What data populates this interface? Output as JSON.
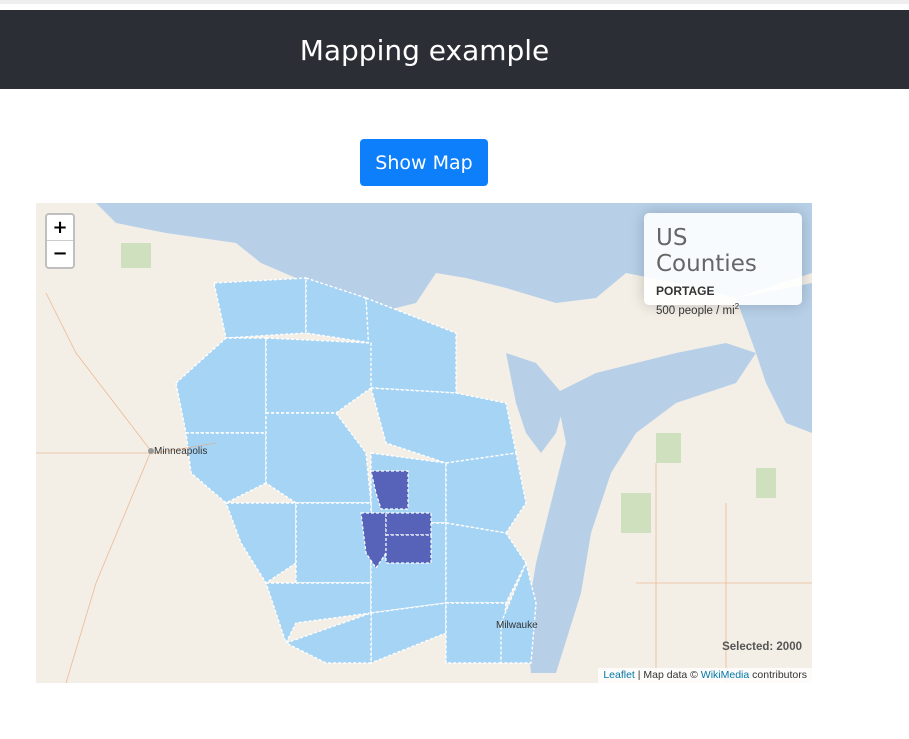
{
  "header": {
    "title": "Mapping example"
  },
  "button": {
    "show_map_label": "Show Map"
  },
  "map": {
    "zoom_in_label": "+",
    "zoom_out_label": "−",
    "info": {
      "title": "US Counties",
      "county": "PORTAGE",
      "density_text": "500 people / mi",
      "density_sup": "2"
    },
    "selected_label": "Selected: 2000",
    "attribution": {
      "leaflet": "Leaflet",
      "sep": "| Map data ©",
      "wikimedia": "WikiMedia",
      "contributors": "contributors"
    },
    "places": {
      "minneapolis": "Minneapolis",
      "milwaukee": "Milwauke"
    },
    "colors": {
      "county_fill": "#a6d4f4",
      "selected_fill": "#5763b8",
      "water": "#b7d0e8",
      "land": "#f3efe7"
    },
    "selected_counties_count": 4
  }
}
